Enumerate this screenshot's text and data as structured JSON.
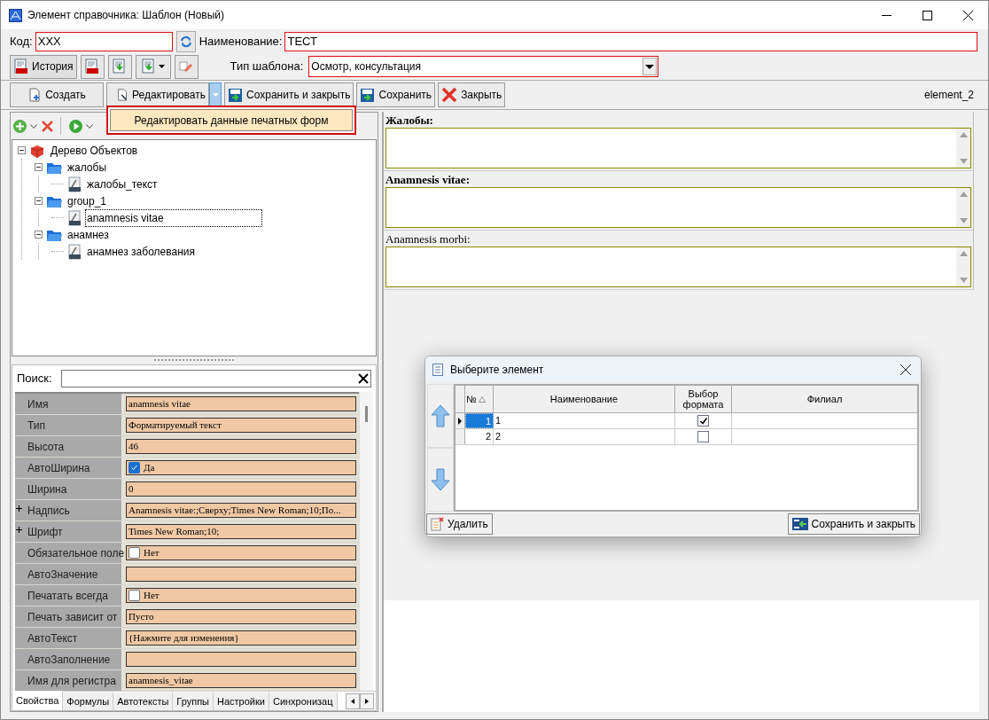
{
  "window": {
    "title": "Элемент справочника: Шаблон (Новый)"
  },
  "header": {
    "code_label": "Код:",
    "code_value": "XXX",
    "name_label": "Наименование:",
    "name_value": "ТЕСТ",
    "history_button": "История",
    "template_type_label": "Тип шаблона:",
    "template_type_value": "Осмотр, консультация"
  },
  "actions": [
    {
      "label": "Создать",
      "kind": "create"
    },
    {
      "label": "Редактировать",
      "kind": "edit"
    },
    {
      "label": "Сохранить и закрыть",
      "kind": "save_close"
    },
    {
      "label": "Сохранить",
      "kind": "save"
    },
    {
      "label": "Закрыть",
      "kind": "close"
    }
  ],
  "element_name": "element_2",
  "edit_menu": {
    "items": [
      "Редактировать данные печатных форм"
    ]
  },
  "tree": {
    "items": [
      {
        "label": "Дерево Объектов",
        "kind": "root",
        "expanded": true,
        "selected": false,
        "children": [
          {
            "label": "жалобы",
            "kind": "group",
            "expanded": true,
            "selected": false,
            "children": [
              {
                "label": "жалобы_текст",
                "kind": "rtf",
                "selected": false
              }
            ]
          },
          {
            "label": "group_1",
            "kind": "group",
            "expanded": true,
            "selected": false,
            "children": [
              {
                "label": "anamnesis vitae",
                "kind": "rtf",
                "selected": true
              }
            ]
          },
          {
            "label": "анамнез",
            "kind": "group",
            "expanded": true,
            "selected": false,
            "children": [
              {
                "label": "анамнез заболевания",
                "kind": "rtf",
                "selected": false
              }
            ]
          }
        ]
      }
    ]
  },
  "properties": {
    "search_label": "Поиск:",
    "rows": [
      {
        "name": "Имя",
        "kind": "text",
        "value": "anamnesis vitae",
        "expandable": false
      },
      {
        "name": "Тип",
        "kind": "text",
        "value": "Форматируемый текст",
        "expandable": false
      },
      {
        "name": "Высота",
        "kind": "text",
        "value": "46",
        "expandable": false
      },
      {
        "name": "АвтоШирина",
        "kind": "checkbox",
        "value": "Да",
        "checked": true,
        "expandable": false
      },
      {
        "name": "Ширина",
        "kind": "text",
        "value": "0",
        "expandable": false
      },
      {
        "name": "Надпись",
        "kind": "text",
        "value": "Anamnesis vitae:;Сверху;Times New Roman;10;По...",
        "expandable": true
      },
      {
        "name": "Шрифт",
        "kind": "text",
        "value": "Times New Roman;10;",
        "expandable": true
      },
      {
        "name": "Обязательное поле",
        "kind": "checkbox",
        "value": "Нет",
        "checked": false,
        "expandable": false
      },
      {
        "name": "АвтоЗначение",
        "kind": "text",
        "expandable": false
      },
      {
        "name": "Печатать всегда",
        "kind": "checkbox",
        "value": "Нет",
        "checked": false,
        "expandable": false
      },
      {
        "name": "Печать зависит от",
        "kind": "text",
        "value": "Пусто",
        "expandable": false
      },
      {
        "name": "АвтоТекст",
        "kind": "text",
        "value": "{Нажмите для изменения}",
        "expandable": false
      },
      {
        "name": "АвтоЗаполнение",
        "kind": "text",
        "expandable": false
      },
      {
        "name": "Имя для регистра",
        "kind": "text",
        "value": "anamnesis_vitae",
        "expandable": false
      }
    ]
  },
  "tabs": [
    {
      "label": "Свойства",
      "selected": true
    },
    {
      "label": "Формулы",
      "selected": false
    },
    {
      "label": "Автотексты",
      "selected": false
    },
    {
      "label": "Группы",
      "selected": false
    },
    {
      "label": "Настройки",
      "selected": false
    },
    {
      "label": "Синхронизац",
      "selected": false
    }
  ],
  "form_fields": [
    {
      "label": "Жалобы:",
      "bold": true
    },
    {
      "label": "Anamnesis vitae:",
      "bold": true
    },
    {
      "label": "Anamnesis morbi:",
      "bold": false
    }
  ],
  "dialog": {
    "title": "Выберите элемент",
    "columns": [
      "№",
      "Наименование",
      "Выбор формата",
      "Филиал"
    ],
    "rows": [
      {
        "number": "1",
        "name": "1",
        "checked": true,
        "selected": true
      },
      {
        "number": "2",
        "name": "2",
        "checked": false,
        "selected": false
      }
    ],
    "delete_button": "Удалить",
    "save_button": "Сохранить и закрыть"
  }
}
